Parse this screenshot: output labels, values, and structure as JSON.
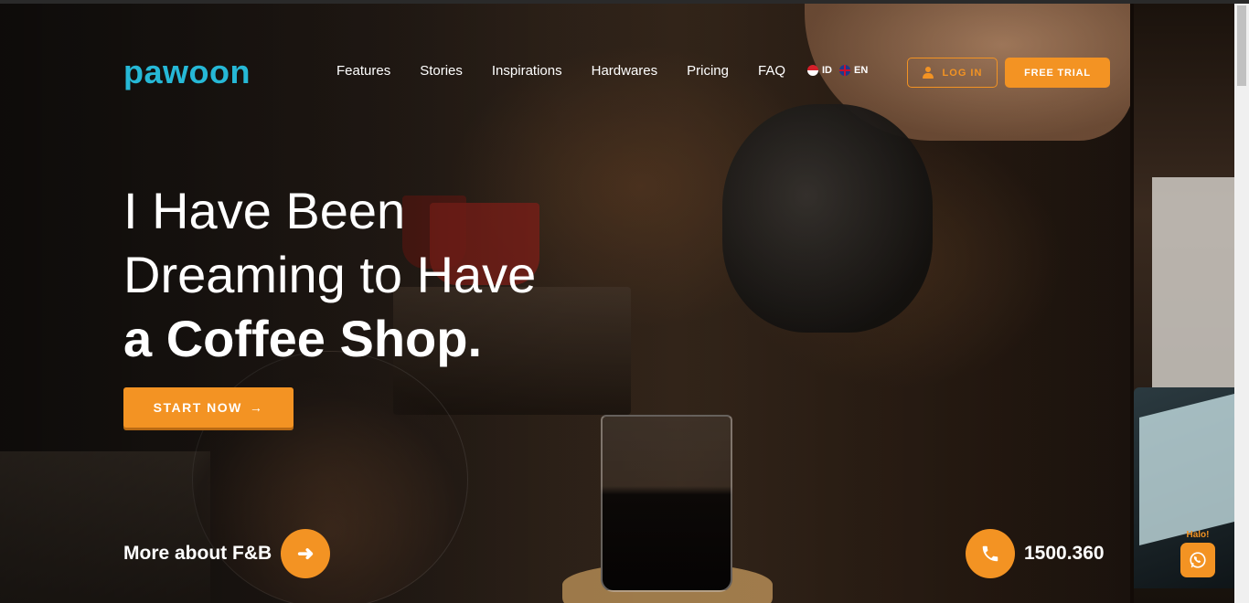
{
  "brand": {
    "logo_text": "pawoon"
  },
  "nav": {
    "items": [
      {
        "label": "Features"
      },
      {
        "label": "Stories"
      },
      {
        "label": "Inspirations"
      },
      {
        "label": "Hardwares"
      },
      {
        "label": "Pricing"
      },
      {
        "label": "FAQ"
      }
    ],
    "languages": [
      {
        "code": "ID",
        "flag": "indonesia-flag-icon"
      },
      {
        "code": "EN",
        "flag": "uk-flag-icon"
      }
    ]
  },
  "header": {
    "login_label": "LOG IN",
    "trial_label": "FREE TRIAL"
  },
  "hero": {
    "headline_line1": "I Have Been",
    "headline_line2": "Dreaming to Have",
    "headline_line3": "a Coffee Shop.",
    "cta_label": "START NOW",
    "cta_icon": "arrow-right-icon",
    "more_label": "More about F&B",
    "phone_number": "1500.360"
  },
  "chat": {
    "label": "Halo!",
    "icon": "whatsapp-icon"
  },
  "colors": {
    "accent": "#f39323",
    "logo": "#26b8d6",
    "text": "#ffffff"
  }
}
